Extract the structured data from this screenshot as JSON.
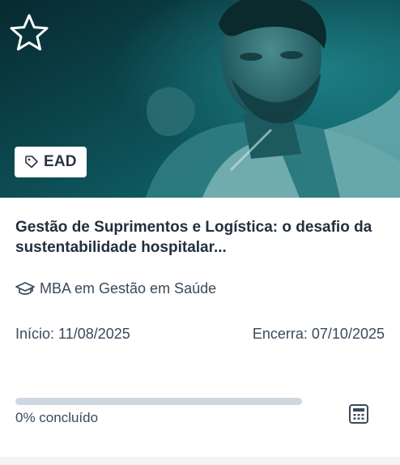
{
  "card": {
    "badge": {
      "icon": "tag-icon",
      "label": "EAD"
    },
    "favorite_icon": "star-outline-icon",
    "title": "Gestão de Suprimentos e Logística: o desafio da sustentabilidade hospitalar...",
    "program": {
      "icon": "graduation-cap-icon",
      "label": "MBA em Gestão em Saúde"
    },
    "start_date": "Início: 11/08/2025",
    "end_date": "Encerra: 07/10/2025",
    "progress": {
      "percent": 0,
      "label": "0% concluído"
    },
    "grades_icon": "calculator-icon",
    "colors": {
      "hero_teal": "#0b5b63",
      "text_dark": "#22303f",
      "text_muted": "#3b4a5a",
      "progress_track": "#cfd8e0"
    }
  }
}
